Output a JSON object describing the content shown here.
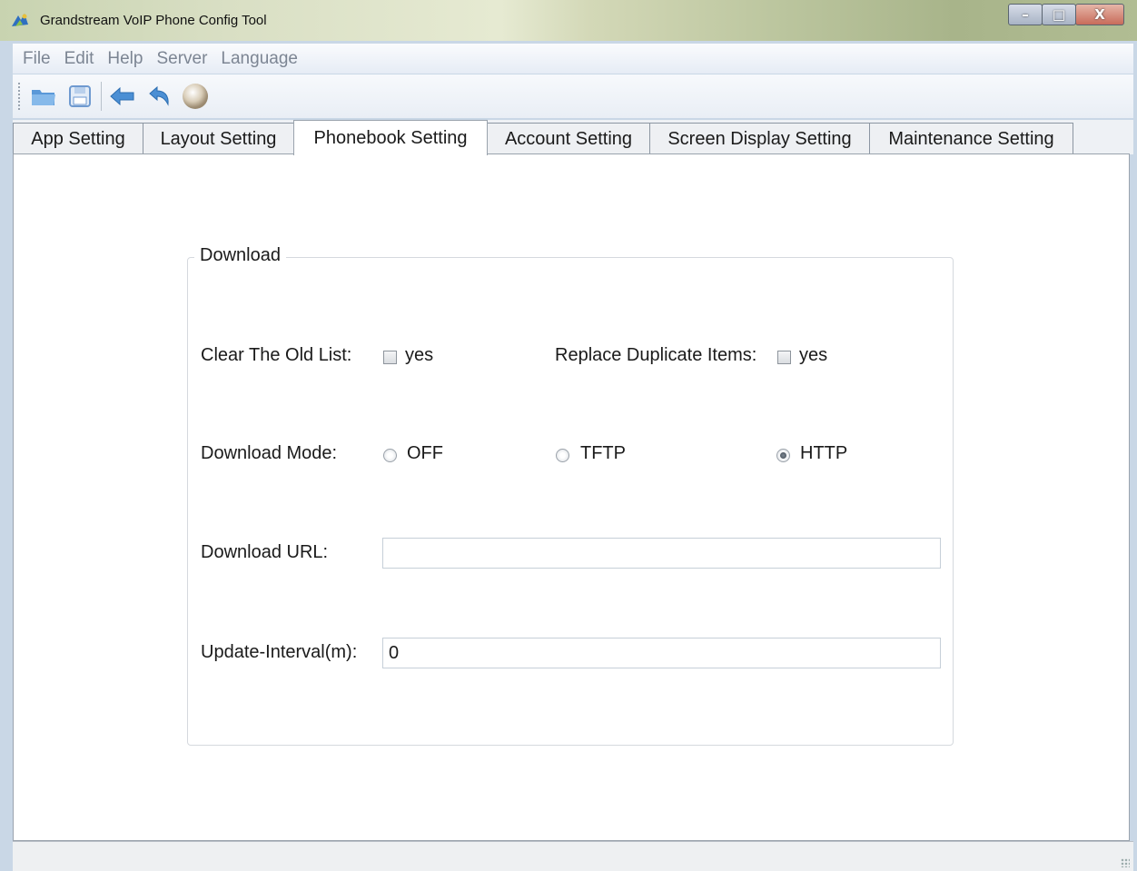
{
  "window": {
    "title": "Grandstream VoIP Phone Config Tool",
    "buttons": {
      "minimize": "–",
      "maximize": "□",
      "close": "X"
    }
  },
  "menu": [
    "File",
    "Edit",
    "Help",
    "Server",
    "Language"
  ],
  "toolbar": {
    "icons": [
      "open-folder-icon",
      "save-icon",
      "back-arrow-icon",
      "undo-icon",
      "orb-icon"
    ]
  },
  "tabs": [
    {
      "label": "App Setting",
      "active": false
    },
    {
      "label": "Layout Setting",
      "active": false
    },
    {
      "label": "Phonebook Setting",
      "active": true
    },
    {
      "label": "Account Setting",
      "active": false
    },
    {
      "label": "Screen Display Setting",
      "active": false
    },
    {
      "label": "Maintenance Setting",
      "active": false
    }
  ],
  "download": {
    "group_title": "Download",
    "clear_old_list": {
      "label": "Clear The Old List:",
      "option": "yes",
      "checked": false
    },
    "replace_duplicates": {
      "label": "Replace Duplicate Items:",
      "option": "yes",
      "checked": false
    },
    "mode": {
      "label": "Download Mode:",
      "options": [
        "OFF",
        "TFTP",
        "HTTP"
      ],
      "selected": "HTTP"
    },
    "url": {
      "label": "Download URL:",
      "value": ""
    },
    "interval": {
      "label": "Update-Interval(m):",
      "value": "0"
    }
  },
  "colors": {
    "accent": "#3a7bc8",
    "window_bg": "#c9d7e6"
  }
}
